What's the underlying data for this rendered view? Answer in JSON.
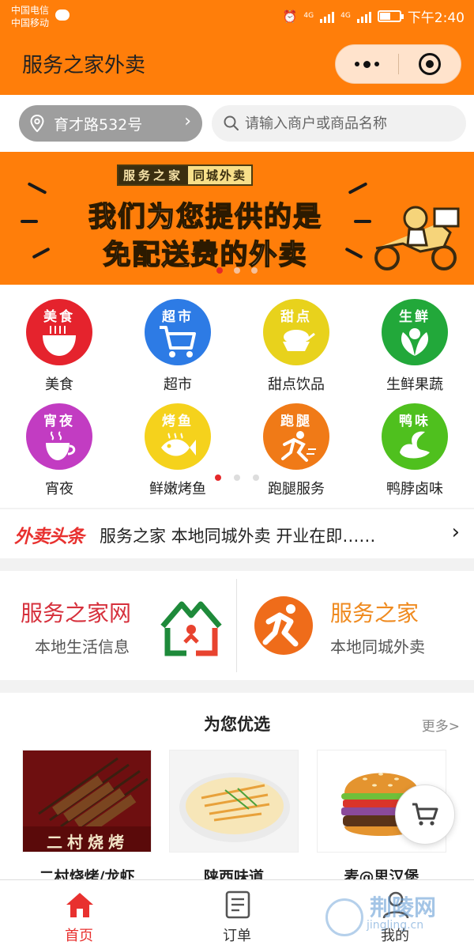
{
  "status_bar": {
    "carrier_1": "中国电信",
    "carrier_2": "中国移动",
    "network_1": "4G",
    "network_2": "4G",
    "time": "下午2:40",
    "icons": [
      "message-icon",
      "alarm-icon",
      "signal-icon",
      "battery-icon"
    ]
  },
  "header": {
    "title": "服务之家外卖",
    "background_color": "#ff7e0a"
  },
  "location": {
    "address": "育才路532号"
  },
  "search": {
    "placeholder": "请输入商户或商品名称",
    "value": ""
  },
  "banner": {
    "tag_left": "服务之家",
    "tag_right": "同城外卖",
    "line_1": "我们为您提供的是",
    "line_2": "免配送费的外卖",
    "slide_count": 3,
    "active_slide": 1
  },
  "categories": {
    "page_count": 3,
    "active_page": 1,
    "items": [
      {
        "label": "美食",
        "glyph": "美食",
        "color": "#e5232d",
        "icon": "noodle-bowl-icon"
      },
      {
        "label": "超市",
        "glyph": "超市",
        "color": "#2d7be5",
        "icon": "shopping-cart-icon"
      },
      {
        "label": "甜点饮品",
        "glyph": "甜点",
        "color": "#e8d21c",
        "icon": "dessert-icon"
      },
      {
        "label": "生鲜果蔬",
        "glyph": "生鲜",
        "color": "#22a83a",
        "icon": "vegetable-icon"
      },
      {
        "label": "宵夜",
        "glyph": "宵夜",
        "color": "#c23cc2",
        "icon": "hot-cup-icon"
      },
      {
        "label": "鲜嫩烤鱼",
        "glyph": "烤鱼",
        "color": "#f5d21c",
        "icon": "fish-icon"
      },
      {
        "label": "跑腿服务",
        "glyph": "跑腿",
        "color": "#f07a17",
        "icon": "runner-icon"
      },
      {
        "label": "鸭脖卤味",
        "glyph": "鸭味",
        "color": "#4fc01e",
        "icon": "duck-icon"
      }
    ]
  },
  "news": {
    "logo": "外卖头条",
    "headline": "服务之家 本地同城外卖 开业在即……"
  },
  "partners": [
    {
      "name": "服务之家网",
      "desc": "本地生活信息",
      "name_color": "#d6303c",
      "icon": "house-logo-icon"
    },
    {
      "name": "服务之家",
      "desc": "本地同城外卖",
      "name_color": "#ef8a1f",
      "icon": "runner-logo-icon"
    }
  ],
  "picks": {
    "title": "为您优选",
    "more": "更多>",
    "items": [
      {
        "name": "二村烧烤/龙虾",
        "image_caption": "二村烧烤",
        "image": "bbq-skewers-photo"
      },
      {
        "name": "陕西味道",
        "image": "cold-noodles-photo"
      },
      {
        "name": "麦@思汉堡",
        "image": "hamburger-photo"
      }
    ]
  },
  "cart": {
    "icon": "cart-icon"
  },
  "tabbar": [
    {
      "label": "首页",
      "icon": "home-icon",
      "active": true
    },
    {
      "label": "订单",
      "icon": "order-list-icon",
      "active": false
    },
    {
      "label": "我的",
      "icon": "user-icon",
      "active": false
    }
  ],
  "watermark": {
    "text": "荆陵网",
    "sub": "jingling.cn"
  },
  "colors": {
    "accent": "#ff7e0a",
    "active_red": "#e8312f"
  }
}
